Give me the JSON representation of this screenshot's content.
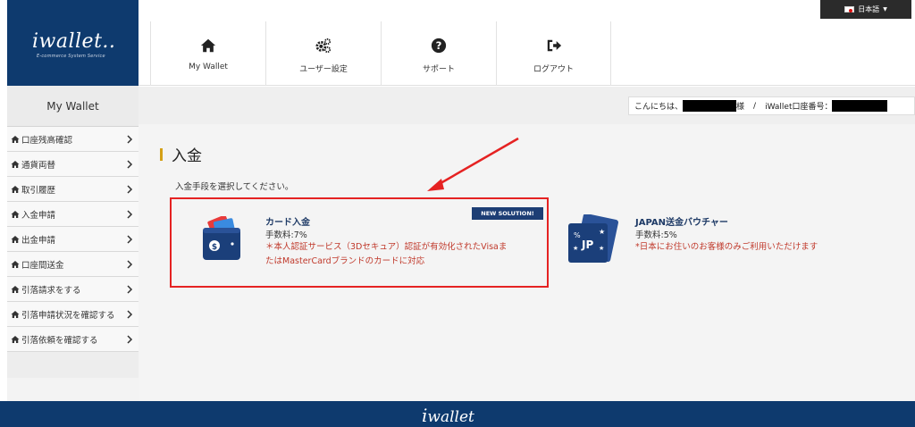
{
  "brand": {
    "logo": "iwallet..",
    "tagline": "E-commerce System Service"
  },
  "language": {
    "label": "日本語"
  },
  "topnav": [
    {
      "label": "My Wallet",
      "icon": "home-icon"
    },
    {
      "label": "ユーザー設定",
      "icon": "gears-icon"
    },
    {
      "label": "サポート",
      "icon": "question-icon"
    },
    {
      "label": "ログアウト",
      "icon": "logout-icon"
    }
  ],
  "sidebar": {
    "title": "My Wallet",
    "items": [
      {
        "label": "口座残高確認"
      },
      {
        "label": "通貨両替"
      },
      {
        "label": "取引履歴"
      },
      {
        "label": "入金申請"
      },
      {
        "label": "出金申請"
      },
      {
        "label": "口座間送金"
      },
      {
        "label": "引落請求をする"
      },
      {
        "label": "引落申請状況を確認する"
      },
      {
        "label": "引落依頼を確認する"
      }
    ]
  },
  "greeting": {
    "prefix": "こんにちは、",
    "honorific": "様",
    "separator": "/",
    "account_label": "iWallet口座番号："
  },
  "page": {
    "title": "入金",
    "instruction": "入金手段を選択してください。",
    "options": [
      {
        "badge": "NEW SOLUTION!",
        "title": "カード入金",
        "fee": "手数料:7%",
        "note_line1": "＊本人認証サービス（3Dセキュア）認証が有効化されたVisaま",
        "note_line2": "たはMasterCardブランドのカードに対応",
        "icon": "wallet-card-icon"
      },
      {
        "title": "JAPAN送金バウチャー",
        "fee": "手数料:5%",
        "note_line1": "*日本にお住いのお客様のみご利用いただけます",
        "icon": "voucher-jp-icon",
        "voucher_text": "JP"
      }
    ]
  },
  "footer": {
    "logo": "wallet"
  },
  "colors": {
    "navy": "#0e3a6e",
    "badge": "#1d3e75",
    "highlight": "#e52222",
    "note": "#c0392b",
    "accent": "#d4a017"
  }
}
